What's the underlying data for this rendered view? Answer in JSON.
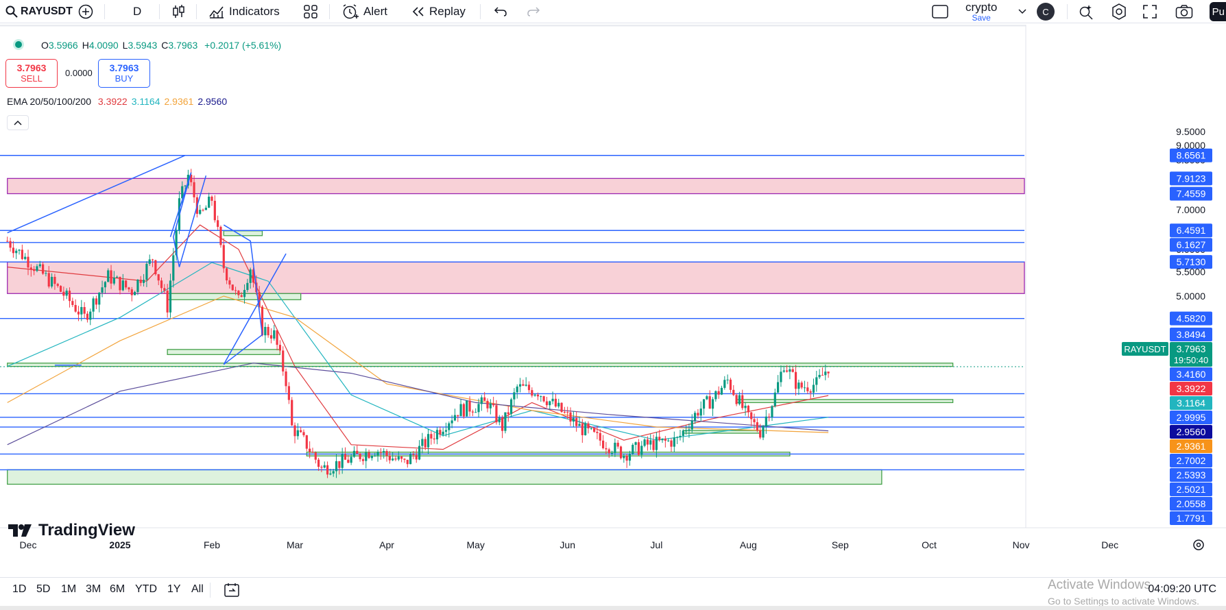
{
  "toolbar": {
    "symbol": "RAYUSDT",
    "interval": "D",
    "indicators": "Indicators",
    "alert": "Alert",
    "replay": "Replay",
    "layout_name": "crypto",
    "layout_status": "Save",
    "badge": "C",
    "publish": "Pu"
  },
  "legend": {
    "ohlc": [
      {
        "label": "O",
        "value": "3.5966"
      },
      {
        "label": "H",
        "value": "4.0090"
      },
      {
        "label": "L",
        "value": "3.5943"
      },
      {
        "label": "C",
        "value": "3.7963"
      }
    ],
    "change": "+0.2017 (+5.61%)",
    "sell_price": "3.7963",
    "sell_label": "SELL",
    "buy_price": "3.7963",
    "buy_label": "BUY",
    "spread": "0.0000",
    "ema_label": "EMA 20/50/100/200",
    "ema_values": [
      {
        "value": "3.3922",
        "color": "#e03a3e"
      },
      {
        "value": "3.1164",
        "color": "#22b5bf"
      },
      {
        "value": "2.9361",
        "color": "#f2a33a"
      },
      {
        "value": "2.9560",
        "color": "#1a1a8c"
      }
    ]
  },
  "branding": {
    "logo_text": "TradingView"
  },
  "bottom": {
    "ranges": [
      "1D",
      "5D",
      "1M",
      "3M",
      "6M",
      "YTD",
      "1Y",
      "All"
    ],
    "clock": "04:09:20 UTC",
    "watermark_title": "Activate Windows",
    "watermark_sub": "Go to Settings to activate Windows."
  },
  "chart_data": {
    "type": "candlestick",
    "symbol": "RAYUSDT",
    "interval": "D",
    "y_scale": "log",
    "ylim": [
      1.75,
      9.6
    ],
    "y_ticks": [
      "9.5000",
      "9.0000",
      "8.5000",
      "8.0000",
      "7.0000",
      "6.0000",
      "5.5000",
      "5.0000"
    ],
    "x_ticks": [
      {
        "label": "Dec",
        "date": "2024-12-01"
      },
      {
        "label": "2025",
        "date": "2025-01-01"
      },
      {
        "label": "Feb",
        "date": "2025-02-01"
      },
      {
        "label": "Mar",
        "date": "2025-03-01"
      },
      {
        "label": "Apr",
        "date": "2025-04-01"
      },
      {
        "label": "May",
        "date": "2025-05-01"
      },
      {
        "label": "Jun",
        "date": "2025-06-01"
      },
      {
        "label": "Jul",
        "date": "2025-07-01"
      },
      {
        "label": "Aug",
        "date": "2025-08-01"
      },
      {
        "label": "Sep",
        "date": "2025-09-01"
      },
      {
        "label": "Oct",
        "date": "2025-10-01"
      },
      {
        "label": "Nov",
        "date": "2025-11-01"
      },
      {
        "label": "Dec",
        "date": "2025-12-01"
      }
    ],
    "close_path": [
      [
        "2024-11-24",
        6.2
      ],
      [
        "2024-12-05",
        5.5
      ],
      [
        "2024-12-12",
        5.1
      ],
      [
        "2024-12-20",
        4.6
      ],
      [
        "2024-12-28",
        5.4
      ],
      [
        "2025-01-05",
        5.1
      ],
      [
        "2025-01-12",
        5.8
      ],
      [
        "2025-01-17",
        4.8
      ],
      [
        "2025-01-21",
        7.2
      ],
      [
        "2025-01-24",
        8.0
      ],
      [
        "2025-01-28",
        6.8
      ],
      [
        "2025-02-01",
        7.3
      ],
      [
        "2025-02-05",
        5.6
      ],
      [
        "2025-02-10",
        4.9
      ],
      [
        "2025-02-14",
        5.6
      ],
      [
        "2025-02-18",
        4.4
      ],
      [
        "2025-02-22",
        4.3
      ],
      [
        "2025-02-26",
        3.6
      ],
      [
        "2025-02-28",
        3.0
      ],
      [
        "2025-03-05",
        2.8
      ],
      [
        "2025-03-10",
        2.55
      ],
      [
        "2025-03-20",
        2.65
      ],
      [
        "2025-03-28",
        2.75
      ],
      [
        "2025-04-07",
        2.6
      ],
      [
        "2025-04-15",
        2.85
      ],
      [
        "2025-04-25",
        3.2
      ],
      [
        "2025-05-05",
        3.3
      ],
      [
        "2025-05-10",
        3.0
      ],
      [
        "2025-05-15",
        3.5
      ],
      [
        "2025-05-22",
        3.45
      ],
      [
        "2025-05-28",
        3.25
      ],
      [
        "2025-06-05",
        3.0
      ],
      [
        "2025-06-12",
        2.85
      ],
      [
        "2025-06-20",
        2.7
      ],
      [
        "2025-06-28",
        2.8
      ],
      [
        "2025-07-08",
        2.85
      ],
      [
        "2025-07-15",
        3.2
      ],
      [
        "2025-07-20",
        3.35
      ],
      [
        "2025-07-25",
        3.6
      ],
      [
        "2025-08-01",
        3.1
      ],
      [
        "2025-08-05",
        2.95
      ],
      [
        "2025-08-10",
        3.4
      ],
      [
        "2025-08-13",
        3.85
      ],
      [
        "2025-08-18",
        3.5
      ],
      [
        "2025-08-24",
        3.55
      ],
      [
        "2025-08-28",
        3.7963
      ]
    ],
    "ema_series": [
      {
        "name": "EMA 20",
        "color": "#e03a3e",
        "points": [
          [
            "2024-11-24",
            5.6
          ],
          [
            "2025-01-10",
            5.3
          ],
          [
            "2025-01-28",
            6.6
          ],
          [
            "2025-02-10",
            6.0
          ],
          [
            "2025-03-01",
            3.8
          ],
          [
            "2025-03-20",
            2.8
          ],
          [
            "2025-04-20",
            2.75
          ],
          [
            "2025-05-20",
            3.3
          ],
          [
            "2025-06-20",
            2.85
          ],
          [
            "2025-07-20",
            3.1
          ],
          [
            "2025-08-28",
            3.3922
          ]
        ]
      },
      {
        "name": "EMA 50",
        "color": "#22b5bf",
        "points": [
          [
            "2024-11-24",
            3.8
          ],
          [
            "2025-01-01",
            4.6
          ],
          [
            "2025-02-01",
            5.7
          ],
          [
            "2025-02-20",
            5.3
          ],
          [
            "2025-03-20",
            3.4
          ],
          [
            "2025-04-20",
            2.9
          ],
          [
            "2025-05-20",
            3.2
          ],
          [
            "2025-07-01",
            2.85
          ],
          [
            "2025-08-28",
            3.1164
          ]
        ]
      },
      {
        "name": "EMA 100",
        "color": "#f2a33a",
        "points": [
          [
            "2024-11-24",
            3.3
          ],
          [
            "2025-01-01",
            4.2
          ],
          [
            "2025-02-05",
            5.0
          ],
          [
            "2025-03-01",
            4.6
          ],
          [
            "2025-04-01",
            3.55
          ],
          [
            "2025-05-20",
            3.2
          ],
          [
            "2025-07-01",
            3.0
          ],
          [
            "2025-08-28",
            2.9361
          ]
        ]
      },
      {
        "name": "EMA 200",
        "color": "#5b4d9a",
        "points": [
          [
            "2024-11-24",
            2.8
          ],
          [
            "2025-01-01",
            3.45
          ],
          [
            "2025-02-15",
            3.85
          ],
          [
            "2025-03-20",
            3.7
          ],
          [
            "2025-05-01",
            3.3
          ],
          [
            "2025-06-15",
            3.15
          ],
          [
            "2025-08-28",
            2.956
          ]
        ]
      }
    ],
    "horizontal_lines": [
      8.6561,
      6.4591,
      6.1627,
      5.713,
      4.582,
      3.416,
      3.1164,
      2.9995,
      2.7002,
      2.5393
    ],
    "zones": [
      {
        "kind": "supply",
        "top": 7.9123,
        "bottom": 7.4559,
        "from": "2024-11-24",
        "to": "2025-12-05"
      },
      {
        "kind": "supply",
        "top": 5.713,
        "bottom": 5.05,
        "from": "2024-11-24",
        "to": "2025-12-20"
      },
      {
        "kind": "demand",
        "top": 3.8494,
        "bottom": 3.8,
        "from": "2024-11-24",
        "to": "2025-10-09"
      },
      {
        "kind": "demand",
        "top": 5.05,
        "bottom": 4.93,
        "from": "2025-01-17",
        "to": "2025-03-03"
      },
      {
        "kind": "demand",
        "top": 6.45,
        "bottom": 6.33,
        "from": "2025-02-05",
        "to": "2025-02-18"
      },
      {
        "kind": "demand",
        "top": 4.06,
        "bottom": 3.98,
        "from": "2025-01-17",
        "to": "2025-02-24"
      },
      {
        "kind": "demand",
        "top": 3.34,
        "bottom": 3.3,
        "from": "2025-07-28",
        "to": "2025-10-09"
      },
      {
        "kind": "demand",
        "top": 2.96,
        "bottom": 2.93,
        "from": "2025-07-10",
        "to": "2025-08-05"
      },
      {
        "kind": "demand",
        "top": 2.72,
        "bottom": 2.68,
        "from": "2025-03-05",
        "to": "2025-08-15"
      },
      {
        "kind": "demand",
        "top": 2.5393,
        "bottom": 2.4,
        "from": "2024-11-24",
        "to": "2025-09-15"
      }
    ],
    "price_labels": [
      {
        "value": "8.6561",
        "bg": "#2962ff",
        "fg": "#ffffff"
      },
      {
        "value": "7.9123",
        "bg": "#2962ff",
        "fg": "#ffffff"
      },
      {
        "value": "7.4559",
        "bg": "#2962ff",
        "fg": "#ffffff"
      },
      {
        "value": "6.4591",
        "bg": "#2962ff",
        "fg": "#ffffff"
      },
      {
        "value": "6.1627",
        "bg": "#2962ff",
        "fg": "#ffffff"
      },
      {
        "value": "5.7130",
        "bg": "#2962ff",
        "fg": "#ffffff"
      },
      {
        "value": "4.5820",
        "bg": "#2962ff",
        "fg": "#ffffff"
      },
      {
        "value": "3.8494",
        "bg": "#2962ff",
        "fg": "#ffffff"
      },
      {
        "value": "3.7963",
        "bg": "#089981",
        "fg": "#ffffff",
        "sub": "19:50:40",
        "tag": "RAYUSDT"
      },
      {
        "value": "3.4160",
        "bg": "#2962ff",
        "fg": "#ffffff"
      },
      {
        "value": "3.3922",
        "bg": "#f23645",
        "fg": "#ffffff"
      },
      {
        "value": "3.1164",
        "bg": "#22b5bf",
        "fg": "#ffffff"
      },
      {
        "value": "2.9995",
        "bg": "#2962ff",
        "fg": "#ffffff"
      },
      {
        "value": "2.9560",
        "bg": "#0c0c9e",
        "fg": "#ffffff"
      },
      {
        "value": "2.9361",
        "bg": "#f7931a",
        "fg": "#ffffff"
      },
      {
        "value": "2.7002",
        "bg": "#2962ff",
        "fg": "#ffffff"
      },
      {
        "value": "2.5393",
        "bg": "#2962ff",
        "fg": "#ffffff"
      },
      {
        "value": "2.5021",
        "bg": "#2962ff",
        "fg": "#ffffff"
      },
      {
        "value": "2.0558",
        "bg": "#2962ff",
        "fg": "#ffffff"
      },
      {
        "value": "1.7791",
        "bg": "#2962ff",
        "fg": "#ffffff"
      }
    ],
    "colors": {
      "up": "#089981",
      "down": "#f23645",
      "line": "#2962ff",
      "zone_supply": "#f7c9d0",
      "zone_demand": "#d8f0d8"
    }
  }
}
